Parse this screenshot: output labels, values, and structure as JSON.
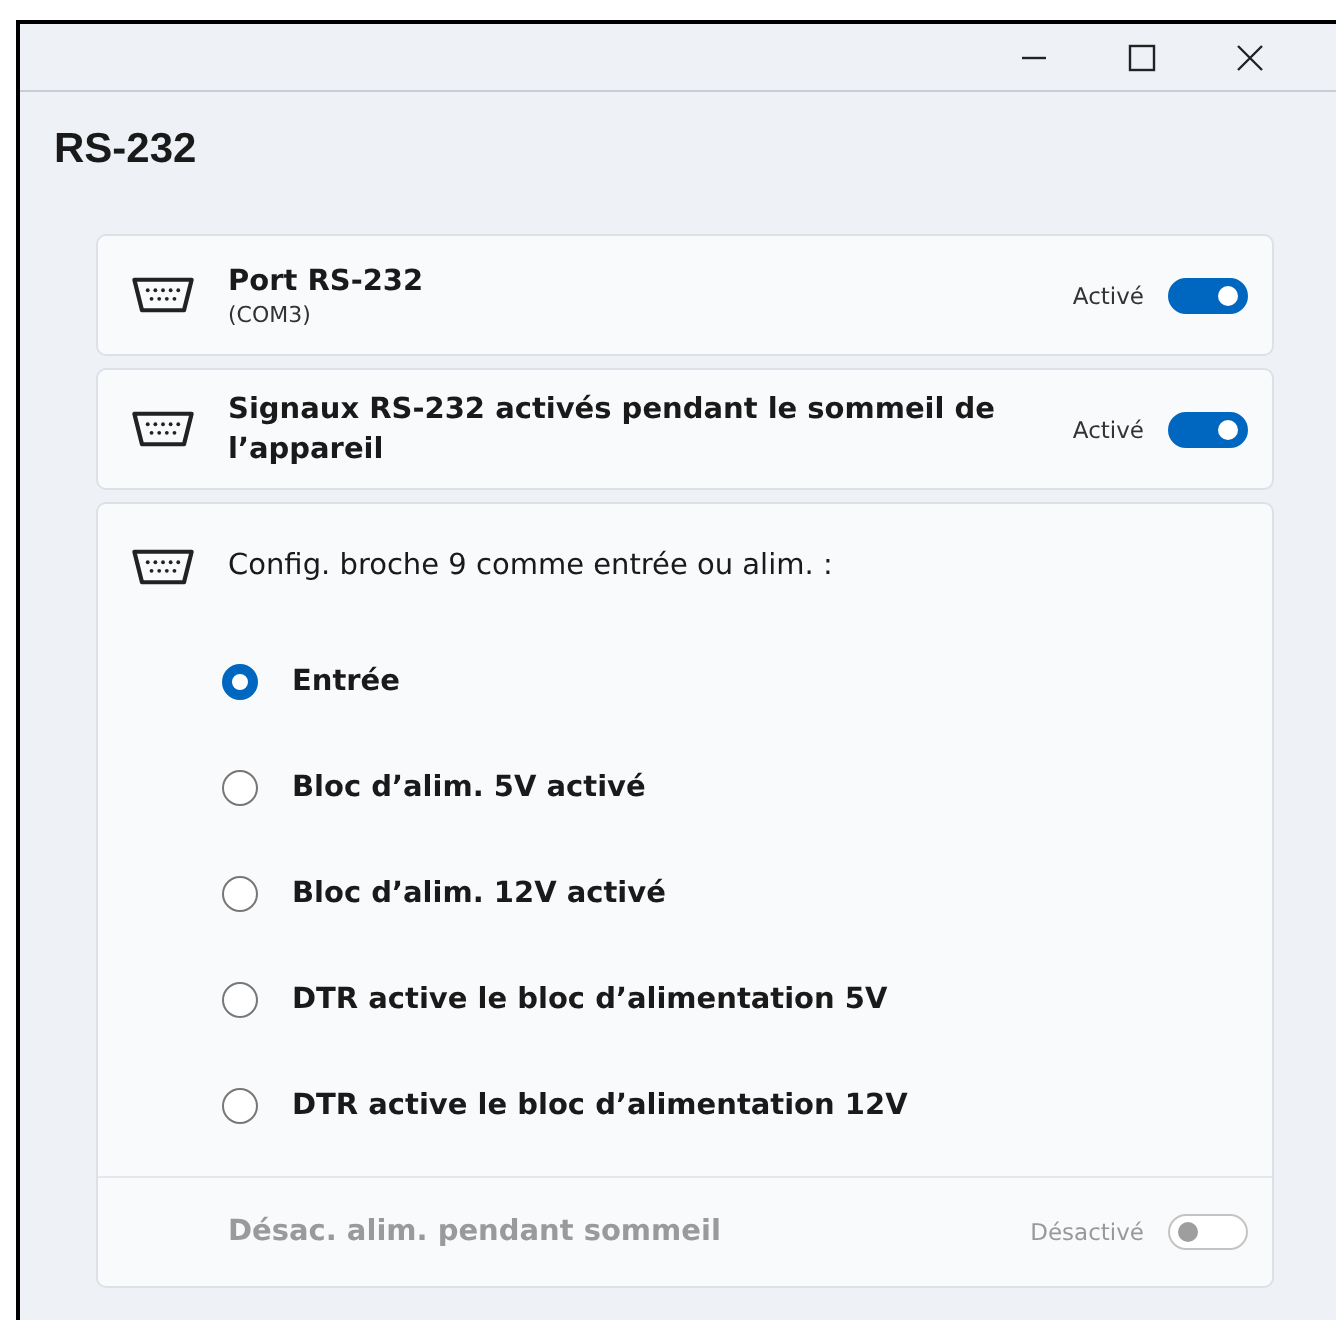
{
  "window": {
    "title": "RS-232"
  },
  "settings": [
    {
      "kind": "toggle",
      "label": "Port RS-232",
      "sublabel": "(COM3)",
      "state_text": "Activé",
      "on": true,
      "disabled": false
    },
    {
      "kind": "toggle",
      "label": "Signaux RS-232 activés pendant le sommeil de l’appareil",
      "state_text": "Activé",
      "on": true,
      "disabled": false
    }
  ],
  "pin9": {
    "label": "Config. broche 9 comme entrée ou alim. :",
    "options": [
      {
        "label": "Entrée",
        "selected": true
      },
      {
        "label": "Bloc d’alim. 5V activé",
        "selected": false
      },
      {
        "label": "Bloc d’alim. 12V activé",
        "selected": false
      },
      {
        "label": "DTR active le bloc d’alimentation 5V",
        "selected": false
      },
      {
        "label": "DTR active le bloc d’alimentation 12V",
        "selected": false
      }
    ],
    "sleep": {
      "label": "Désac. alim. pendant sommeil",
      "state_text": "Désactivé",
      "on": false,
      "disabled": true
    }
  }
}
